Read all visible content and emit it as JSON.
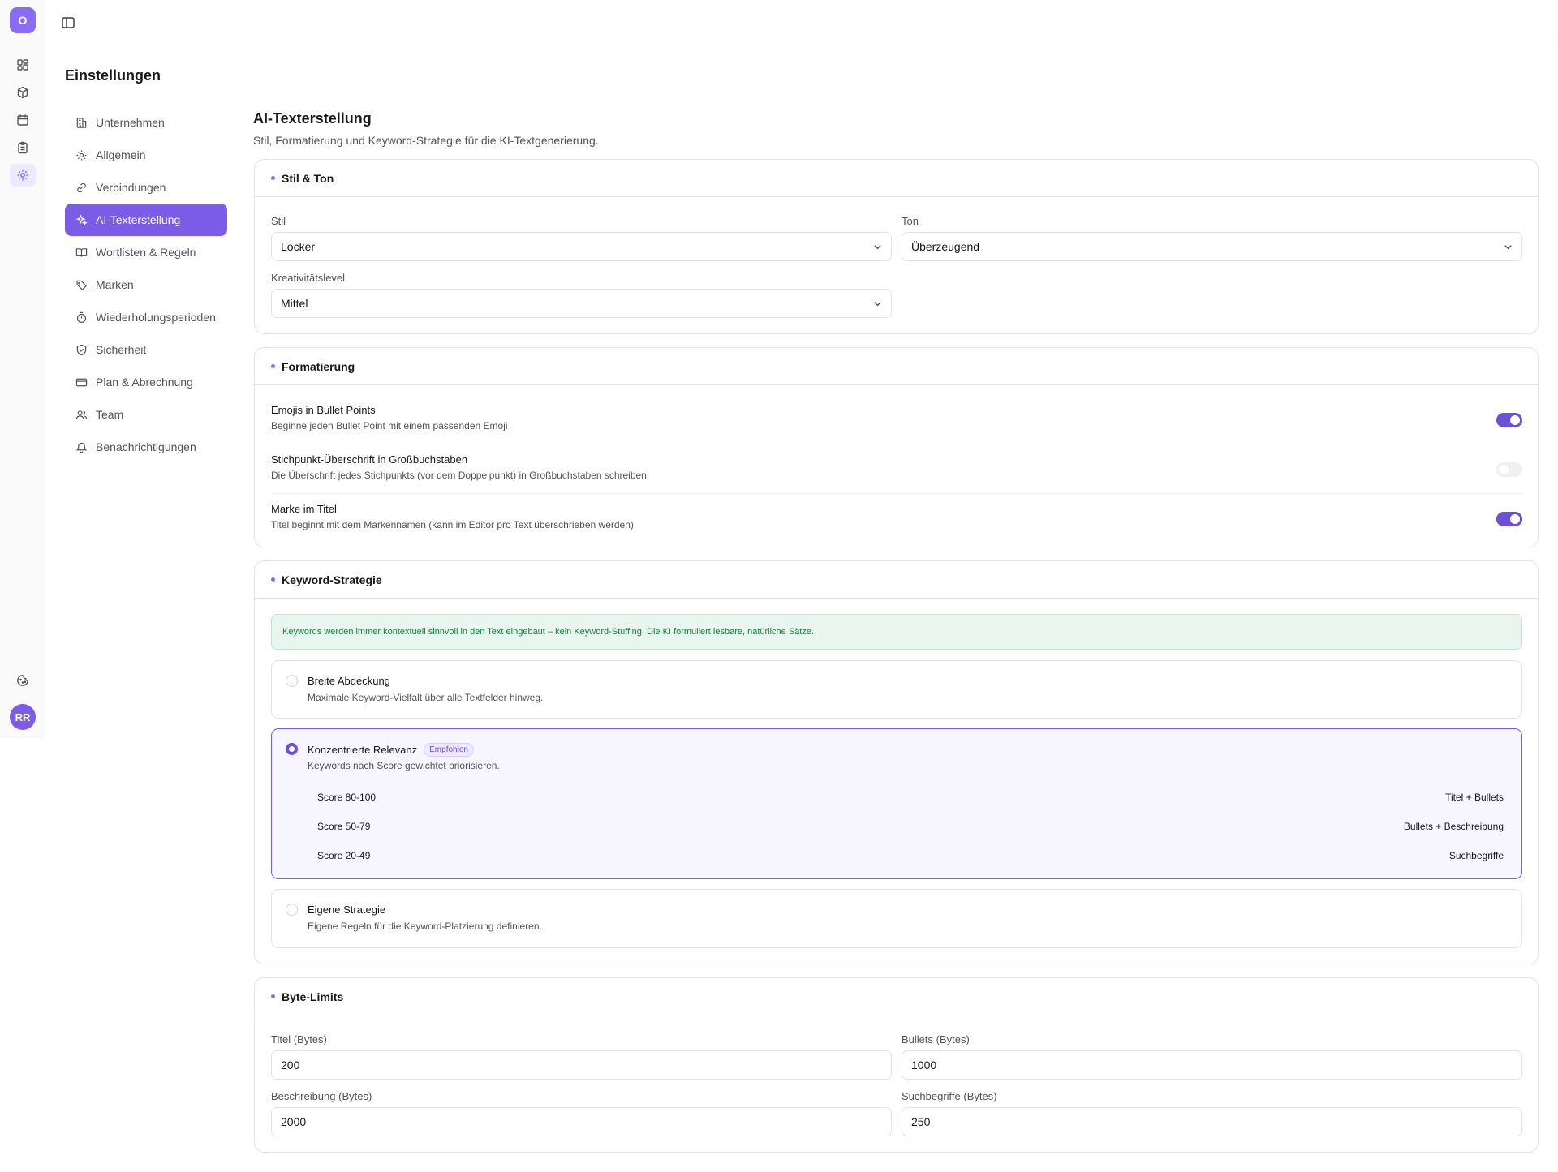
{
  "app": {
    "logo_letter": "O",
    "user_initials": "RR"
  },
  "page": {
    "title": "Einstellungen"
  },
  "nav": [
    {
      "label": "Unternehmen",
      "icon": "building-icon",
      "active": false
    },
    {
      "label": "Allgemein",
      "icon": "gear-icon",
      "active": false
    },
    {
      "label": "Verbindungen",
      "icon": "link-icon",
      "active": false
    },
    {
      "label": "AI-Texterstellung",
      "icon": "sparkles-icon",
      "active": true
    },
    {
      "label": "Wortlisten & Regeln",
      "icon": "book-icon",
      "active": false
    },
    {
      "label": "Marken",
      "icon": "tag-icon",
      "active": false
    },
    {
      "label": "Wiederholungsperioden",
      "icon": "timer-icon",
      "active": false
    },
    {
      "label": "Sicherheit",
      "icon": "shield-icon",
      "active": false
    },
    {
      "label": "Plan & Abrechnung",
      "icon": "credit-card-icon",
      "active": false
    },
    {
      "label": "Team",
      "icon": "users-icon",
      "active": false
    },
    {
      "label": "Benachrichtigungen",
      "icon": "bell-icon",
      "active": false
    }
  ],
  "section": {
    "title": "AI-Texterstellung",
    "subtitle": "Stil, Formatierung und Keyword-Strategie für die KI-Textgenerierung."
  },
  "style_card": {
    "title": "Stil & Ton",
    "stil_label": "Stil",
    "stil_value": "Locker",
    "ton_label": "Ton",
    "ton_value": "Überzeugend",
    "kreativ_label": "Kreativitätslevel",
    "kreativ_value": "Mittel"
  },
  "format_card": {
    "title": "Formatierung",
    "rows": [
      {
        "title": "Emojis in Bullet Points",
        "desc": "Beginne jeden Bullet Point mit einem passenden Emoji",
        "on": true
      },
      {
        "title": "Stichpunkt-Überschrift in Großbuchstaben",
        "desc": "Die Überschrift jedes Stichpunkts (vor dem Doppelpunkt) in Großbuchstaben schreiben",
        "on": false
      },
      {
        "title": "Marke im Titel",
        "desc": "Titel beginnt mit dem Markennamen (kann im Editor pro Text überschrieben werden)",
        "on": true
      }
    ]
  },
  "keyword_card": {
    "title": "Keyword-Strategie",
    "notice": "Keywords werden immer kontextuell sinnvoll in den Text eingebaut – kein Keyword-Stuffing. Die KI formuliert lesbare, natürliche Sätze.",
    "options": [
      {
        "title": "Breite Abdeckung",
        "desc": "Maximale Keyword-Vielfalt über alle Textfelder hinweg.",
        "selected": false
      },
      {
        "title": "Konzentrierte Relevanz",
        "badge": "Empfohlen",
        "desc": "Keywords nach Score gewichtet priorisieren.",
        "selected": true,
        "scores": [
          {
            "range": "Score 80-100",
            "target": "Titel + Bullets"
          },
          {
            "range": "Score 50-79",
            "target": "Bullets + Beschreibung"
          },
          {
            "range": "Score 20-49",
            "target": "Suchbegriffe"
          }
        ]
      },
      {
        "title": "Eigene Strategie",
        "desc": "Eigene Regeln für die Keyword-Platzierung definieren.",
        "selected": false
      }
    ]
  },
  "byte_card": {
    "title": "Byte-Limits",
    "titel_label": "Titel (Bytes)",
    "titel_value": "200",
    "bullets_label": "Bullets (Bytes)",
    "bullets_value": "1000",
    "beschreibung_label": "Beschreibung (Bytes)",
    "beschreibung_value": "2000",
    "such_label": "Suchbegriffe (Bytes)",
    "such_value": "250"
  },
  "colors": {
    "accent": "#7b5ce6",
    "success_bg": "#e8f6ef",
    "success_text": "#15803d"
  }
}
